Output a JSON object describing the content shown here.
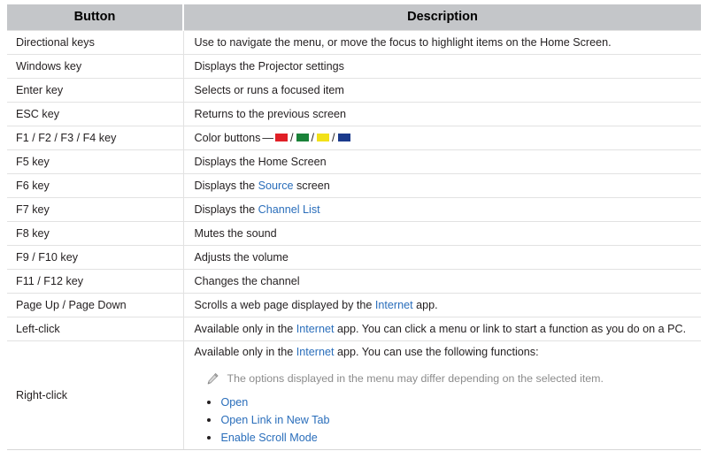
{
  "table": {
    "headers": {
      "button": "Button",
      "description": "Description"
    },
    "header_bg": "#c4c6c9",
    "link_color": "#2a6ebb",
    "rows": [
      {
        "button": "Directional keys",
        "description": "Use to navigate the menu, or move the focus to highlight items on the Home Screen."
      },
      {
        "button": "Windows key",
        "description": "Displays the Projector settings"
      },
      {
        "button": "Enter key",
        "description": "Selects or runs a focused item"
      },
      {
        "button": "ESC key",
        "description": "Returns to the previous screen"
      },
      {
        "button": "F1 / F2 / F3 / F4 key",
        "description_prefix": "Color buttons",
        "dash": "—",
        "color_swatches": [
          "#e01f26",
          "#1a8239",
          "#f2e118",
          "#1b3a8c"
        ],
        "swatch_separator": "/"
      },
      {
        "button": "F5 key",
        "description": "Displays the Home Screen"
      },
      {
        "button": "F6 key",
        "description_before": "Displays the ",
        "link": "Source",
        "description_after": " screen"
      },
      {
        "button": "F7 key",
        "description_before": "Displays the ",
        "link": "Channel List",
        "description_after": ""
      },
      {
        "button": "F8 key",
        "description": "Mutes the sound"
      },
      {
        "button": "F9 / F10 key",
        "description": "Adjusts the volume"
      },
      {
        "button": "F11 / F12 key",
        "description": "Changes the channel"
      },
      {
        "button": "Page Up / Page Down",
        "description_before": "Scrolls a web page displayed by the ",
        "link": "Internet",
        "description_after": " app."
      },
      {
        "button": "Left-click",
        "description_before": "Available only in the ",
        "link": "Internet",
        "description_after": " app. You can click a menu or link to start a function as you do on a PC."
      },
      {
        "button": "Right-click",
        "description_before": "Available only in the ",
        "link": "Internet",
        "description_after": " app. You can use the following functions:",
        "note": "The options displayed in the menu may differ depending on the selected item.",
        "note_icon": "pencil-icon",
        "functions": [
          "Open",
          "Open Link in New Tab",
          "Enable Scroll Mode"
        ]
      }
    ]
  }
}
